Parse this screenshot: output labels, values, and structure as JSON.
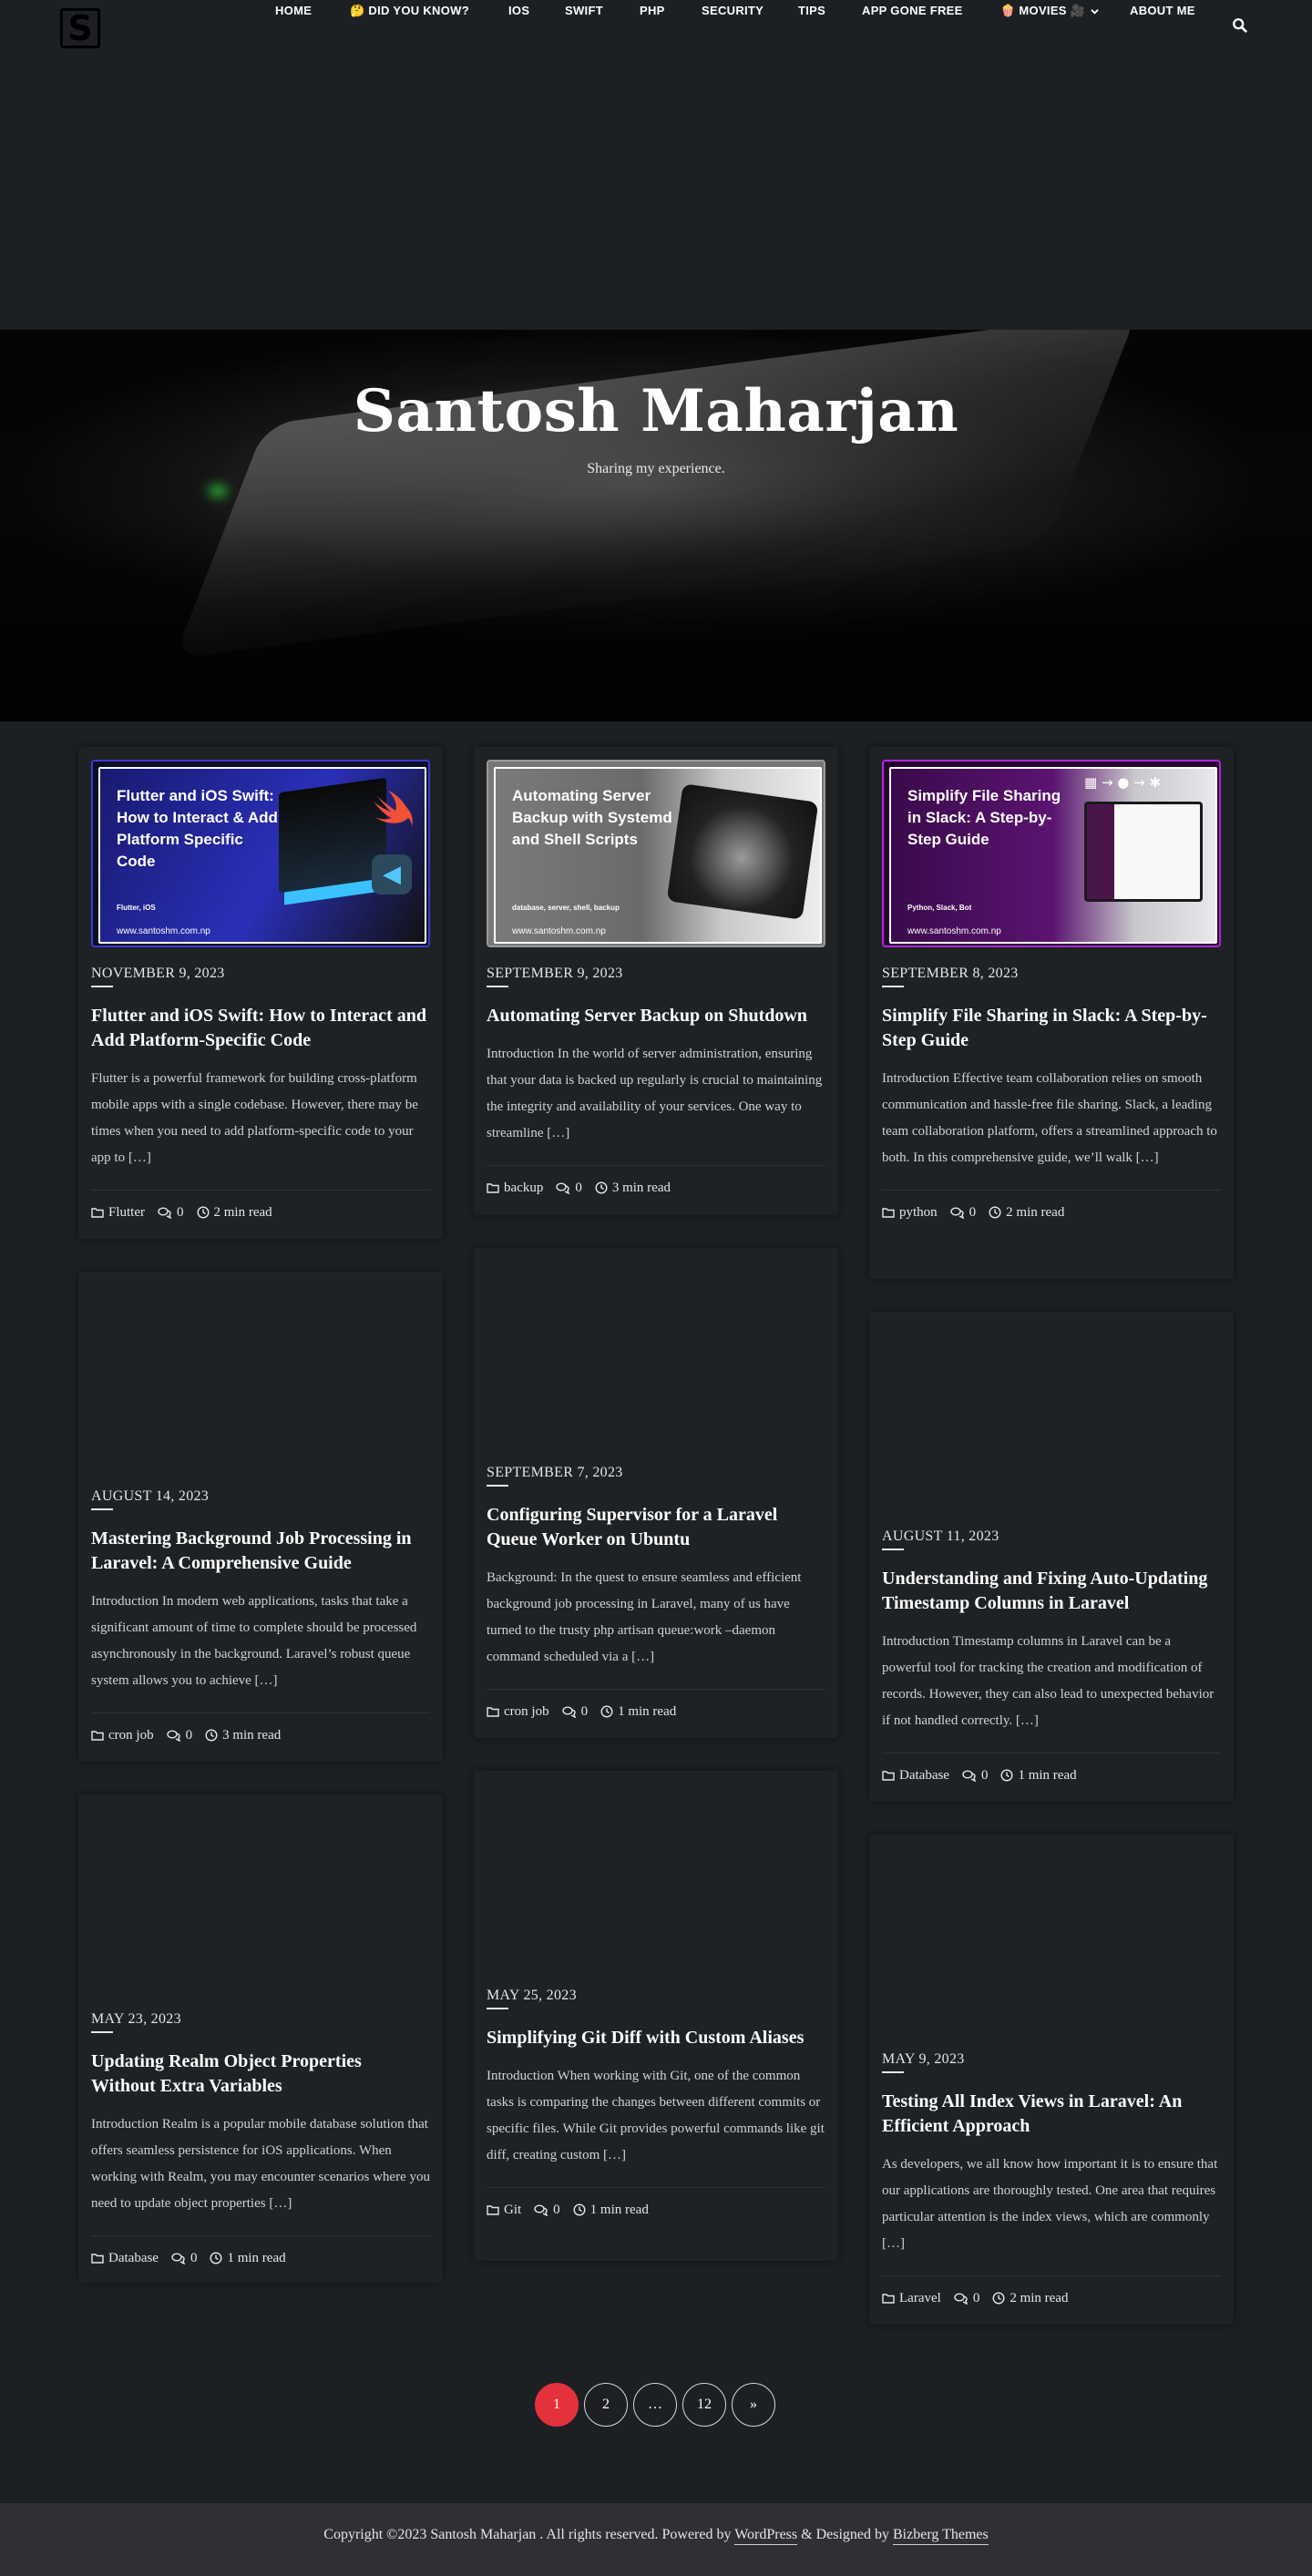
{
  "site": {
    "logo_letter": "S",
    "title": "Santosh Maharjan",
    "tagline": "Sharing my experience."
  },
  "nav": {
    "items": [
      "HOME",
      "🤔 DID YOU KNOW?",
      "IOS",
      "SWIFT",
      "PHP",
      "SECURITY",
      "TIPS",
      "APP GONE FREE",
      "🍿 MOVIES 🎥",
      "ABOUT ME"
    ],
    "search_icon": "search-icon"
  },
  "posts": [
    {
      "thumb": {
        "title": "Flutter and iOS Swift: How to Interact & Add Platform Specific Code",
        "tags": "Flutter, iOS",
        "url": "www.santoshm.com.np"
      },
      "date": "NOVEMBER 9, 2023",
      "title": "Flutter and iOS Swift: How to Interact and Add Platform-Specific Code",
      "excerpt": "Flutter is a powerful framework for building cross-platform mobile apps with a single codebase. However, there may be times when you need to add platform-specific code to your app to […]",
      "category": "Flutter",
      "comments": "0",
      "read": "2 min read"
    },
    {
      "thumb": {
        "title": "Automating Server Backup with Systemd and Shell Scripts",
        "tags": "database, server, shell, backup",
        "url": "www.santoshm.com.np"
      },
      "date": "SEPTEMBER 9, 2023",
      "title": "Automating Server Backup on Shutdown",
      "excerpt": "Introduction In the world of server administration, ensuring that your data is backed up regularly is crucial to maintaining the integrity and availability of your services. One way to streamline […]",
      "category": "backup",
      "comments": "0",
      "read": "3 min read"
    },
    {
      "thumb": {
        "title": "Simplify File Sharing in Slack: A Step-by-Step Guide",
        "tags": "Python, Slack, Bot",
        "url": "www.santoshm.com.np"
      },
      "date": "SEPTEMBER 8, 2023",
      "title": "Simplify File Sharing in Slack: A Step-by-Step Guide",
      "excerpt": "Introduction Effective team collaboration relies on smooth communication and hassle-free file sharing. Slack, a leading team collaboration platform, offers a streamlined approach to both. In this comprehensive guide, we’ll walk […]",
      "category": "python",
      "comments": "0",
      "read": "2 min read"
    },
    {
      "date": "AUGUST 14, 2023",
      "title": "Mastering Background Job Processing in Laravel: A Comprehensive Guide",
      "excerpt": "Introduction In modern web applications, tasks that take a significant amount of time to complete should be processed asynchronously in the background. Laravel’s robust queue system allows you to achieve […]",
      "category": "cron job",
      "comments": "0",
      "read": "3 min read"
    },
    {
      "date": "SEPTEMBER 7, 2023",
      "title": "Configuring Supervisor for a Laravel Queue Worker on Ubuntu",
      "excerpt": "Background: In the quest to ensure seamless and efficient background job processing in Laravel, many of us have turned to the trusty php artisan queue:work –daemon command scheduled via a […]",
      "category": "cron job",
      "comments": "0",
      "read": "1 min read"
    },
    {
      "date": "AUGUST 11, 2023",
      "title": "Understanding and Fixing Auto-Updating Timestamp Columns in Laravel",
      "excerpt": "Introduction Timestamp columns in Laravel can be a powerful tool for tracking the creation and modification of records. However, they can also lead to unexpected behavior if not handled correctly. […]",
      "category": "Database",
      "comments": "0",
      "read": "1 min read"
    },
    {
      "date": "MAY 23, 2023",
      "title": "Updating Realm Object Properties Without Extra Variables",
      "excerpt": "Introduction Realm is a popular mobile database solution that offers seamless persistence for iOS applications. When working with Realm, you may encounter scenarios where you need to update object properties […]",
      "category": "Database",
      "comments": "0",
      "read": "1 min read"
    },
    {
      "date": "MAY 25, 2023",
      "title": "Simplifying Git Diff with Custom Aliases",
      "excerpt": "Introduction When working with Git, one of the common tasks is comparing the changes between different commits or specific files. While Git provides powerful commands like git diff, creating custom […]",
      "category": "Git",
      "comments": "0",
      "read": "1 min read"
    },
    {
      "date": "MAY 9, 2023",
      "title": "Testing All Index Views in Laravel: An Efficient Approach",
      "excerpt": "As developers, we all know how important it is to ensure that our applications are thoroughly tested. One area that requires particular attention is the index views, which are commonly […]",
      "category": "Laravel",
      "comments": "0",
      "read": "2 min read"
    }
  ],
  "pagination": [
    "1",
    "2",
    "…",
    "12",
    "»"
  ],
  "footer": {
    "text_before": "Copyright ©2023 Santosh Maharjan . All rights reserved. Powered by ",
    "wordpress": "WordPress",
    "text_mid": " & Designed by ",
    "theme": "Bizberg Themes"
  },
  "colors": {
    "background": "#1c2023",
    "card": "#1e2225",
    "accent": "#e4313a",
    "footer": "#2f3033"
  }
}
